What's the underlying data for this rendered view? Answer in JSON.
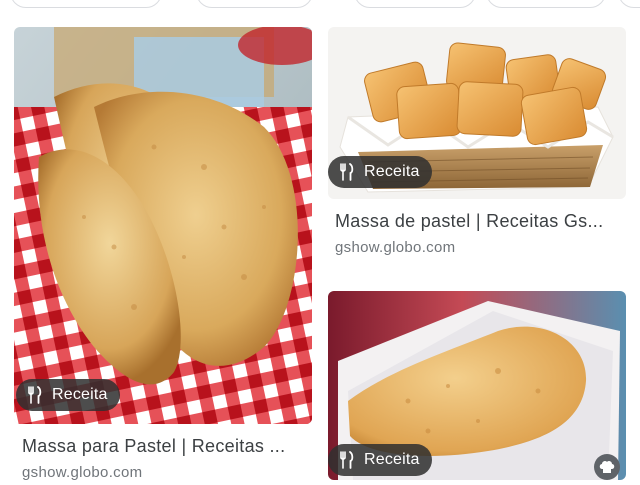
{
  "results": [
    {
      "title": "Massa para Pastel | Receitas ...",
      "source": "gshow.globo.com",
      "badge_label": "Receita",
      "badge_icon": "fork-knife-icon"
    },
    {
      "title": "Massa de pastel | Receitas Gs...",
      "source": "gshow.globo.com",
      "badge_label": "Receita",
      "badge_icon": "fork-knife-icon"
    },
    {
      "title": "",
      "source": "",
      "badge_label": "Receita",
      "badge_icon": "fork-knife-icon"
    }
  ],
  "colors": {
    "badge_bg": "#303030",
    "title": "#3c4043",
    "source": "#70757a",
    "chip_border": "#dadce0"
  }
}
